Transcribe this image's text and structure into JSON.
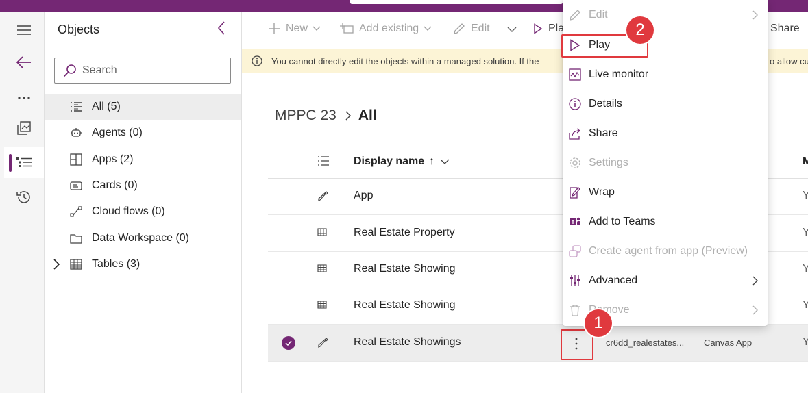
{
  "left_rail": {
    "items": [
      {
        "name": "hamburger-menu",
        "icon": "hamburger-icon"
      },
      {
        "name": "back",
        "icon": "back-arrow-icon"
      },
      {
        "name": "more",
        "icon": "ellipsis-icon"
      },
      {
        "name": "pages",
        "icon": "pages-icon"
      },
      {
        "name": "objects",
        "icon": "tree-list-icon",
        "active": true
      },
      {
        "name": "history",
        "icon": "history-icon"
      }
    ]
  },
  "objects_panel": {
    "title": "Objects",
    "search_placeholder": "Search",
    "items": [
      {
        "label": "All",
        "count": "(5)",
        "selected": true
      },
      {
        "label": "Agents",
        "count": "(0)"
      },
      {
        "label": "Apps",
        "count": "(2)"
      },
      {
        "label": "Cards",
        "count": "(0)"
      },
      {
        "label": "Cloud flows",
        "count": "(0)"
      },
      {
        "label": "Data Workspace",
        "count": "(0)"
      },
      {
        "label": "Tables",
        "count": "(3)",
        "expandable": true
      }
    ]
  },
  "command_bar": {
    "new": "New",
    "add_existing": "Add existing",
    "edit": "Edit",
    "play_partial": "Pla",
    "share": "Share"
  },
  "banner": {
    "text": "You cannot directly edit the objects within a managed solution. If the",
    "text_end": "o allow cu"
  },
  "breadcrumb": {
    "parent": "MPPC 23",
    "current": "All"
  },
  "grid": {
    "header": {
      "display_name": "Display name",
      "sort": "↑",
      "next_col_initial": "M"
    },
    "rows": [
      {
        "name": "App",
        "icon": "canvas-app-icon",
        "y": "Y"
      },
      {
        "name": "Real Estate Property",
        "icon": "table-icon",
        "y": "Y"
      },
      {
        "name": "Real Estate Showing",
        "icon": "table-icon",
        "y": "Y"
      },
      {
        "name": "Real Estate Showing",
        "icon": "table-icon",
        "y": "Y"
      },
      {
        "name": "Real Estate Showings",
        "icon": "canvas-app-icon",
        "selected": true,
        "col2": "cr6dd_realestates...",
        "col3": "Canvas App",
        "y": "Y"
      }
    ]
  },
  "context_menu": {
    "items": [
      {
        "label": "Edit",
        "disabled": true,
        "submenu": true,
        "icon": "pencil-icon"
      },
      {
        "label": "Play",
        "icon": "play-icon"
      },
      {
        "label": "Live monitor",
        "icon": "monitor-icon"
      },
      {
        "label": "Details",
        "icon": "info-icon"
      },
      {
        "label": "Share",
        "icon": "share-icon"
      },
      {
        "label": "Settings",
        "disabled": true,
        "icon": "gear-icon"
      },
      {
        "label": "Wrap",
        "icon": "wrap-icon"
      },
      {
        "label": "Add to Teams",
        "icon": "teams-icon"
      },
      {
        "label": "Create agent from app (Preview)",
        "disabled": true,
        "icon": "agent-icon"
      },
      {
        "label": "Advanced",
        "submenu": true,
        "icon": "advanced-icon"
      },
      {
        "label": "Remove",
        "disabled": true,
        "submenu": true,
        "icon": "trash-icon"
      }
    ]
  },
  "callouts": {
    "step1": "1",
    "step2": "2"
  },
  "colors": {
    "brand": "#742774",
    "highlight": "#e0393e",
    "banner_bg": "#fcf4d6"
  }
}
